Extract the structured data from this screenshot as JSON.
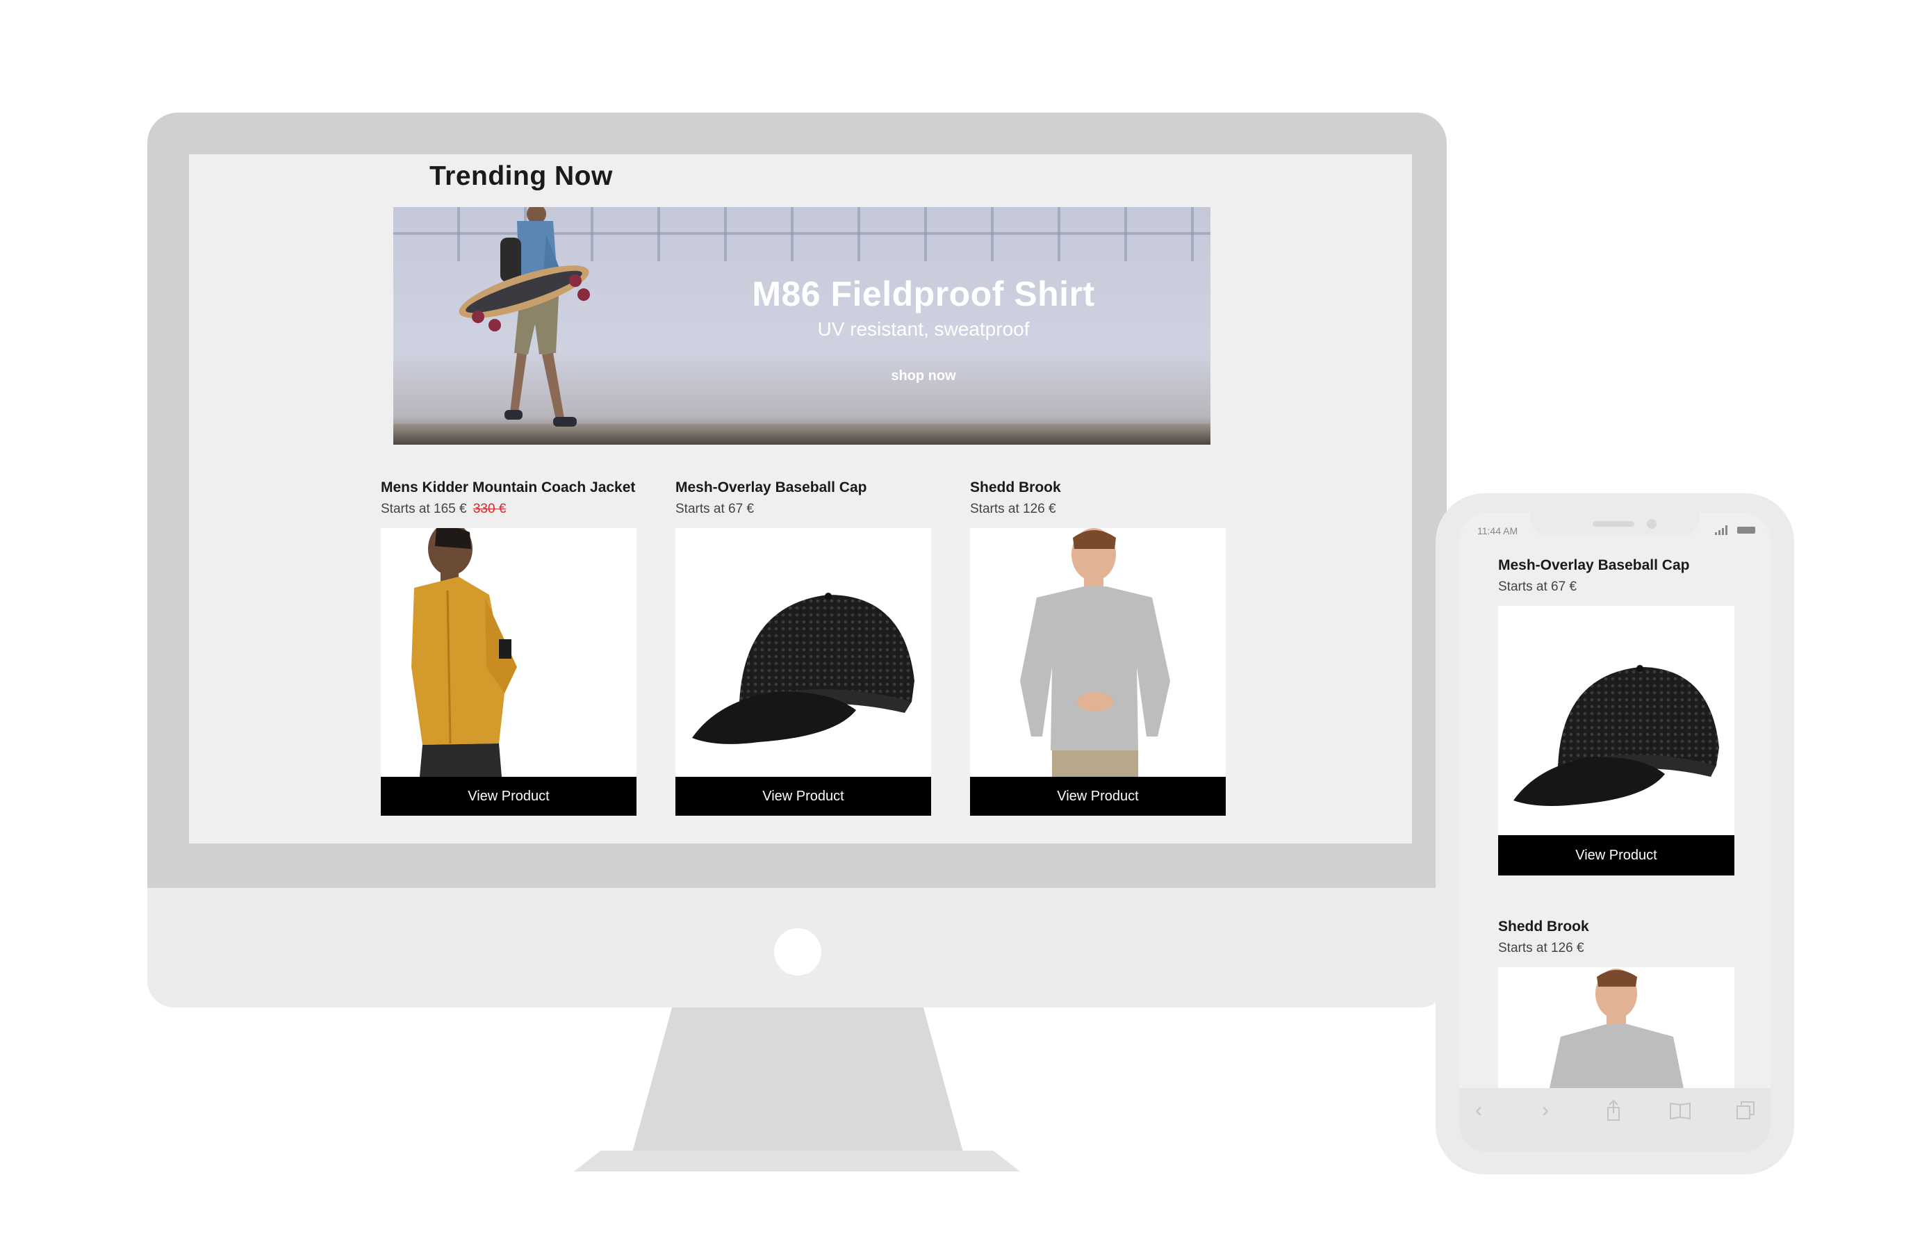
{
  "desktop": {
    "section_title": "Trending Now",
    "hero": {
      "headline": "M86 Fieldproof Shirt",
      "subheadline": "UV resistant, sweatproof",
      "cta": "shop now"
    },
    "products": [
      {
        "name": "Mens Kidder Mountain Coach Jacket",
        "price": "Starts at 165 €",
        "old_price": "330 €",
        "button": "View Product"
      },
      {
        "name": "Mesh-Overlay Baseball Cap",
        "price": "Starts at 67 €",
        "button": "View Product"
      },
      {
        "name": "Shedd Brook",
        "price": "Starts at 126 €",
        "button": "View Product"
      }
    ]
  },
  "phone": {
    "status_time": "11:44 AM",
    "products": [
      {
        "name": "Mesh-Overlay Baseball Cap",
        "price": "Starts at 67 €",
        "button": "View Product"
      },
      {
        "name": "Shedd Brook",
        "price": "Starts at 126 €"
      }
    ],
    "toolbar_icons": [
      "back-icon",
      "forward-icon",
      "share-icon",
      "bookmarks-icon",
      "tabs-icon"
    ]
  },
  "colors": {
    "button_bg": "#000000",
    "sale_price": "#e2252a",
    "screen_bg": "#efefef",
    "jacket": "#d49a2c"
  }
}
